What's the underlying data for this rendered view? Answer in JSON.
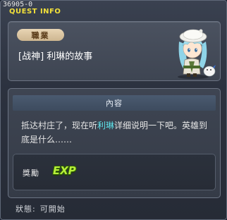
{
  "window": {
    "quest_id": "36905-0",
    "title": "QUEST INFO"
  },
  "job": {
    "badge": "職業",
    "quest_name": "[战神] 利琳的故事"
  },
  "content": {
    "header": "內容",
    "desc_part1": "抵达村庄了，现在听",
    "desc_highlight": "利琳",
    "desc_part2": "详细说明一下吧。英雄到底是什么……",
    "reward_label": "獎勵",
    "reward_exp": "EXP"
  },
  "status": {
    "label": "狀態:",
    "value": "可開始"
  },
  "colors": {
    "title": "#f3e13a",
    "highlight": "#5fe6ee",
    "exp": "#b7f03a"
  }
}
